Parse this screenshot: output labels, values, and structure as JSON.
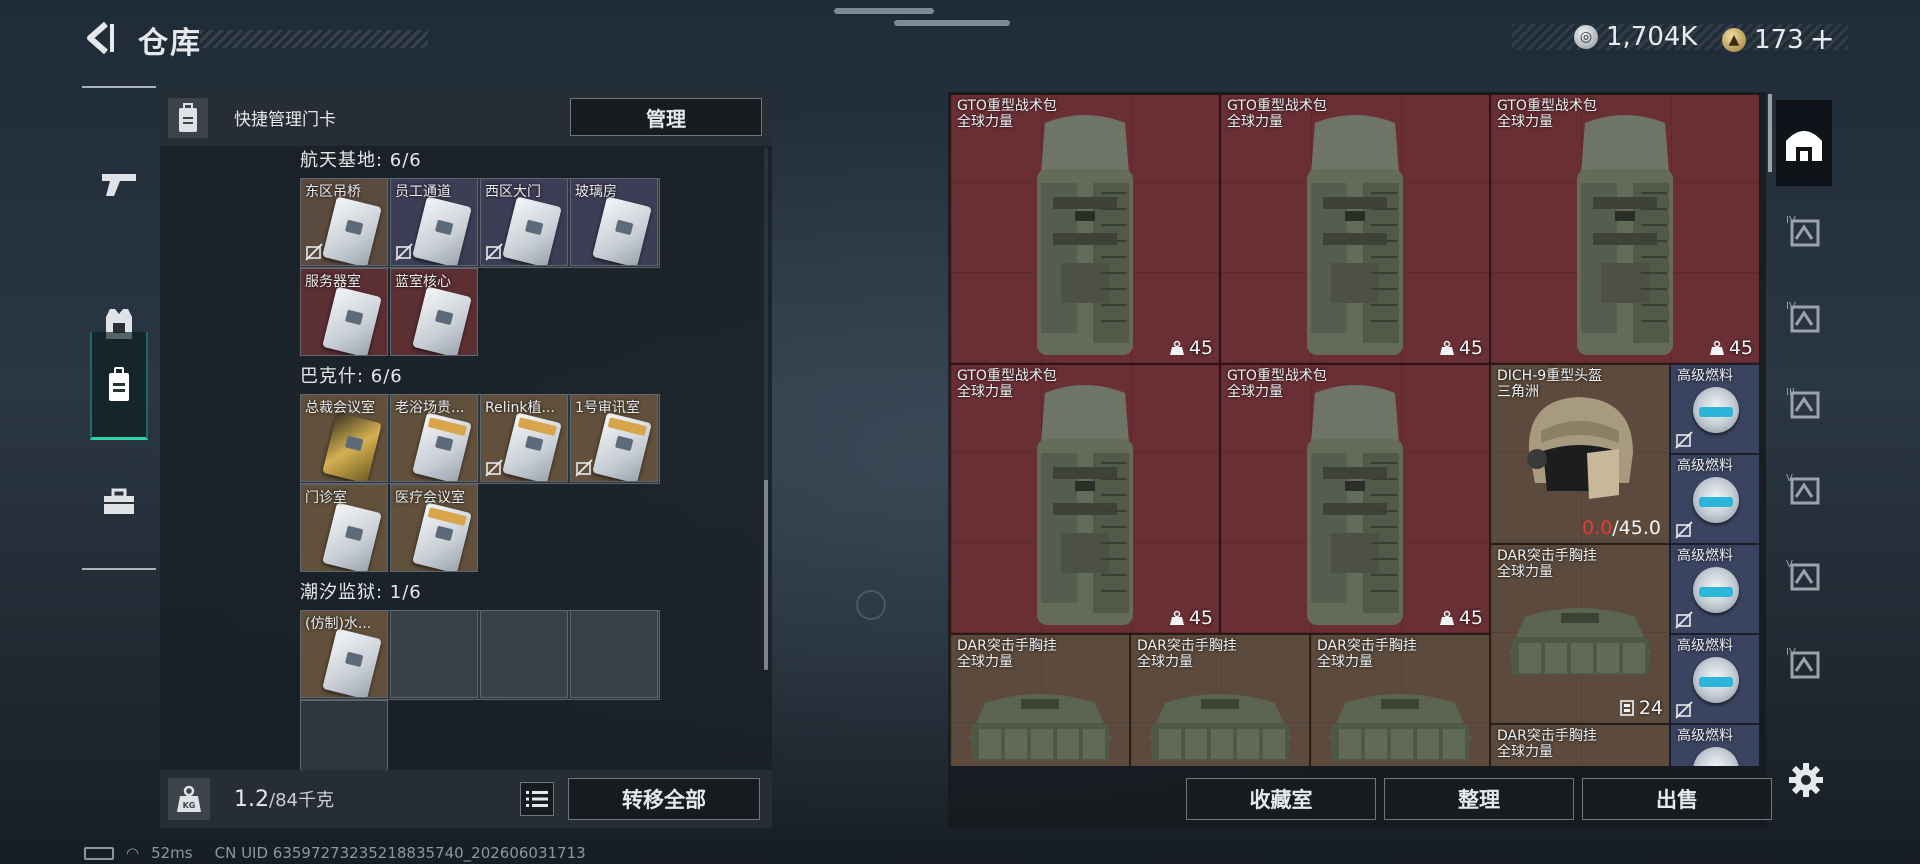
{
  "header": {
    "title": "仓库",
    "currencies": [
      {
        "icon": "silver-coin-icon",
        "value": "1,704K"
      },
      {
        "icon": "gold-coin-icon",
        "value": "173"
      }
    ],
    "add_label": "+"
  },
  "left_rail": {
    "items": [
      {
        "icon": "gun-icon",
        "active": false
      },
      {
        "icon": "armor-vest-icon",
        "active": false
      },
      {
        "icon": "keycard-icon",
        "active": true
      },
      {
        "icon": "toolbox-icon",
        "active": false
      }
    ]
  },
  "keycard_panel": {
    "header_label": "快捷管理门卡",
    "manage_button": "管理",
    "sections": [
      {
        "title": "航天基地: 6/6",
        "cards": [
          {
            "name": "东区吊桥",
            "color": "brown",
            "no_lock": true
          },
          {
            "name": "员工通道",
            "color": "purple",
            "no_lock": true
          },
          {
            "name": "西区大门",
            "color": "purple",
            "no_lock": true
          },
          {
            "name": "玻璃房",
            "color": "purple",
            "no_lock": false
          },
          {
            "name": "服务器室",
            "color": "red",
            "no_lock": false
          },
          {
            "name": "蓝室核心",
            "color": "red",
            "no_lock": false
          }
        ]
      },
      {
        "title": "巴克什: 6/6",
        "cards": [
          {
            "name": "总裁会议室",
            "color": "amber",
            "style": "gold",
            "no_lock": false
          },
          {
            "name": "老浴场贵...",
            "color": "amber",
            "style": "amber",
            "no_lock": false
          },
          {
            "name": "Relink植...",
            "color": "amber",
            "style": "amber",
            "no_lock": true
          },
          {
            "name": "1号审讯室",
            "color": "amber",
            "style": "amber",
            "no_lock": true
          },
          {
            "name": "门诊室",
            "color": "amber",
            "style": "plain",
            "no_lock": false
          },
          {
            "name": "医疗会议室",
            "color": "amber",
            "style": "amber",
            "no_lock": false
          }
        ]
      },
      {
        "title": "潮汐监狱: 1/6",
        "cards": [
          {
            "name": "(仿制)水...",
            "color": "amber",
            "style": "plain",
            "no_lock": false
          }
        ]
      }
    ],
    "footer": {
      "weight_value": "1.2",
      "weight_cap": "/84千克",
      "transfer_button": "转移全部"
    }
  },
  "stash": {
    "items": [
      {
        "name": "GTO重型战术包",
        "tag": "全球力量",
        "count": "45",
        "kind": "backpack"
      },
      {
        "name": "GTO重型战术包",
        "tag": "全球力量",
        "count": "45",
        "kind": "backpack"
      },
      {
        "name": "GTO重型战术包",
        "tag": "全球力量",
        "count": "45",
        "kind": "backpack"
      },
      {
        "name": "GTO重型战术包",
        "tag": "全球力量",
        "count": "45",
        "kind": "backpack"
      },
      {
        "name": "GTO重型战术包",
        "tag": "全球力量",
        "count": "45",
        "kind": "backpack"
      },
      {
        "name": "DICH-9重型头盔",
        "tag": "三角洲",
        "durability_current": "0.0",
        "durability_max": "/45.0",
        "kind": "helmet"
      },
      {
        "name": "DAR突击手胸挂",
        "tag": "全球力量",
        "count": "24",
        "kind": "rig"
      },
      {
        "name": "DAR突击手胸挂",
        "tag": "全球力量",
        "kind": "rig"
      },
      {
        "name": "DAR突击手胸挂",
        "tag": "全球力量",
        "kind": "rig"
      },
      {
        "name": "DAR突击手胸挂",
        "tag": "全球力量",
        "kind": "rig"
      },
      {
        "name": "DAR突击手胸挂",
        "tag": "全球力量",
        "kind": "rig"
      },
      {
        "name": "高级燃料",
        "kind": "fuel"
      },
      {
        "name": "高级燃料",
        "kind": "fuel"
      },
      {
        "name": "高级燃料",
        "kind": "fuel"
      },
      {
        "name": "高级燃料",
        "kind": "fuel"
      },
      {
        "name": "高级燃料",
        "kind": "fuel"
      }
    ],
    "buttons": {
      "collection": "收藏室",
      "organize": "整理",
      "sell": "出售"
    }
  },
  "right_rail": {
    "items": [
      {
        "icon": "stash-home-icon",
        "label": ""
      },
      {
        "icon": "tier-4-backpack-icon",
        "label": "IV"
      },
      {
        "icon": "tier-4-backpack-icon",
        "label": "IV"
      },
      {
        "icon": "tier-3-backpack-icon",
        "label": "III"
      },
      {
        "icon": "tier-5-case-icon",
        "label": "V"
      },
      {
        "icon": "tier-5-case-icon",
        "label": "V"
      },
      {
        "icon": "tier-4-add-icon",
        "label": "IV"
      }
    ]
  },
  "status_bar": {
    "ping": "52ms",
    "uid": "CN UID 635972732352188357​40_202606031713"
  },
  "colors": {
    "accent_green": "#2fd3a7",
    "item_red": "#6a2f35",
    "item_tan": "#5c4b3d",
    "item_blue": "#3a4461",
    "durability_red": "#e23b3b"
  }
}
